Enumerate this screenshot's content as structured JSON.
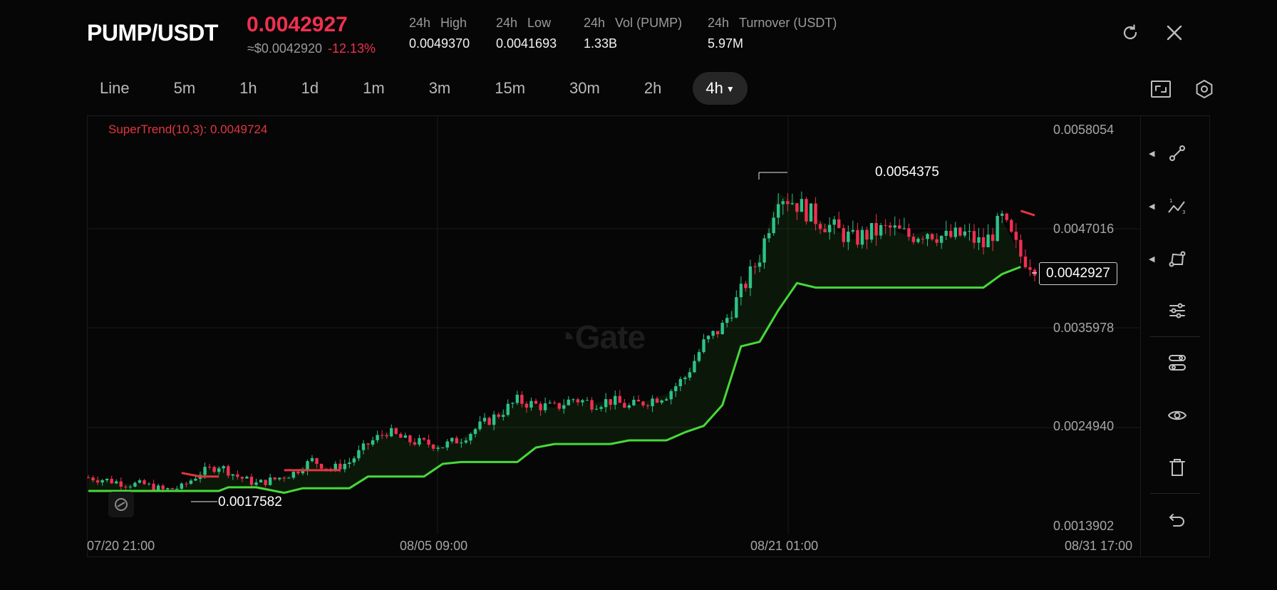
{
  "header": {
    "pair": "PUMP/USDT",
    "last_price": "0.0042927",
    "approx": "≈$0.0042920",
    "change": "-12.13%",
    "stats": [
      {
        "period": "24h",
        "label": "High",
        "value": "0.0049370"
      },
      {
        "period": "24h",
        "label": "Low",
        "value": "0.0041693"
      },
      {
        "period": "24h",
        "label": "Vol (PUMP)",
        "value": "1.33B"
      },
      {
        "period": "24h",
        "label": "Turnover (USDT)",
        "value": "5.97M"
      }
    ]
  },
  "intervals": {
    "items": [
      "Line",
      "5m",
      "1h",
      "1d",
      "1m",
      "3m",
      "15m",
      "30m",
      "2h",
      "4h"
    ],
    "selected": "4h"
  },
  "indicator_label": "SuperTrend(10,3): 0.0049724",
  "watermark": "Gate",
  "chart_data": {
    "type": "candlestick",
    "interval": "4h",
    "indicator": "SuperTrend(10,3)",
    "indicator_value": 0.0049724,
    "y_ticks": [
      "0.0058054",
      "0.0047016",
      "0.0035978",
      "0.0024940",
      "0.0013902"
    ],
    "ylim": [
      0.0013902,
      0.0058054
    ],
    "x_ticks": [
      "07/20 21:00",
      "08/05 09:00",
      "08/21 01:00",
      "08/31 17:00"
    ],
    "high_label": "0.0054375",
    "low_label": "0.0017582",
    "current_price_label": "0.0042927",
    "close_path": [
      [
        0,
        0.00195
      ],
      [
        4,
        0.00192
      ],
      [
        8,
        0.00188
      ],
      [
        12,
        0.00187
      ],
      [
        16,
        0.00181
      ],
      [
        20,
        0.00184
      ],
      [
        24,
        0.002
      ],
      [
        28,
        0.00208
      ],
      [
        32,
        0.00196
      ],
      [
        36,
        0.00188
      ],
      [
        40,
        0.00193
      ],
      [
        44,
        0.002
      ],
      [
        48,
        0.00214
      ],
      [
        52,
        0.00204
      ],
      [
        56,
        0.00212
      ],
      [
        60,
        0.00232
      ],
      [
        64,
        0.00246
      ],
      [
        68,
        0.00236
      ],
      [
        72,
        0.00233
      ],
      [
        76,
        0.0023
      ],
      [
        80,
        0.00238
      ],
      [
        84,
        0.00252
      ],
      [
        88,
        0.00265
      ],
      [
        92,
        0.0028
      ],
      [
        96,
        0.00275
      ],
      [
        100,
        0.00272
      ],
      [
        104,
        0.00282
      ],
      [
        108,
        0.00277
      ],
      [
        112,
        0.0028
      ],
      [
        116,
        0.00273
      ],
      [
        120,
        0.0028
      ],
      [
        124,
        0.00287
      ],
      [
        128,
        0.00306
      ],
      [
        132,
        0.00343
      ],
      [
        136,
        0.00362
      ],
      [
        140,
        0.004
      ],
      [
        144,
        0.0044
      ],
      [
        148,
        0.0051
      ],
      [
        152,
        0.00498
      ],
      [
        156,
        0.00482
      ],
      [
        160,
        0.0047
      ],
      [
        164,
        0.00458
      ],
      [
        168,
        0.00466
      ],
      [
        172,
        0.0047
      ],
      [
        176,
        0.00462
      ],
      [
        180,
        0.00468
      ],
      [
        184,
        0.0046
      ],
      [
        188,
        0.00464
      ],
      [
        192,
        0.00452
      ],
      [
        196,
        0.0048
      ],
      [
        200,
        0.0044
      ],
      [
        203,
        0.00429
      ]
    ],
    "supertrend_up": [
      [
        0,
        0.0018
      ],
      [
        28,
        0.0018
      ],
      [
        30,
        0.00184
      ],
      [
        36,
        0.00184
      ],
      [
        42,
        0.00178
      ],
      [
        46,
        0.00183
      ],
      [
        56,
        0.00183
      ],
      [
        60,
        0.00196
      ],
      [
        72,
        0.00196
      ],
      [
        76,
        0.0021
      ],
      [
        80,
        0.00212
      ],
      [
        92,
        0.00212
      ],
      [
        96,
        0.00228
      ],
      [
        100,
        0.00232
      ],
      [
        112,
        0.00232
      ],
      [
        116,
        0.00236
      ],
      [
        124,
        0.00236
      ],
      [
        128,
        0.00245
      ],
      [
        132,
        0.00252
      ],
      [
        136,
        0.00275
      ],
      [
        140,
        0.0034
      ],
      [
        144,
        0.00345
      ],
      [
        148,
        0.0038
      ],
      [
        152,
        0.0041
      ],
      [
        156,
        0.00405
      ],
      [
        160,
        0.00405
      ],
      [
        176,
        0.00405
      ],
      [
        192,
        0.00405
      ],
      [
        196,
        0.0042
      ],
      [
        200,
        0.00428
      ]
    ],
    "supertrend_down": [
      [
        20,
        0.002
      ],
      [
        24,
        0.00196
      ],
      [
        28,
        0.00196
      ],
      [
        42,
        0.00203
      ],
      [
        54,
        0.00203
      ],
      [
        200,
        0.0049
      ],
      [
        203,
        0.00485
      ]
    ],
    "n_candles": 204
  }
}
